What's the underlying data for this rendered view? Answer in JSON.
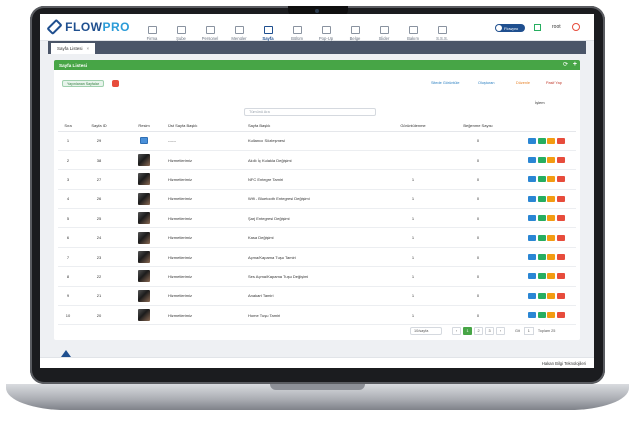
{
  "header": {
    "logo_prefix": "FLOW",
    "logo_suffix": "PRO",
    "nav": [
      {
        "label": "Firma",
        "active": false
      },
      {
        "label": "Şube",
        "active": false
      },
      {
        "label": "Personel",
        "active": false
      },
      {
        "label": "Menüler",
        "active": false
      },
      {
        "label": "Sayfa",
        "active": true
      },
      {
        "label": "Bölüm",
        "active": false
      },
      {
        "label": "Pop-Up",
        "active": false
      },
      {
        "label": "Belge",
        "active": false
      },
      {
        "label": "Slider",
        "active": false
      },
      {
        "label": "Bakım",
        "active": false
      },
      {
        "label": "S.S.S.",
        "active": false
      }
    ],
    "toggle_label": "Flowpro",
    "user": "root"
  },
  "tabs": [
    {
      "label": "Sayfa Listesi",
      "close": "×"
    }
  ],
  "panel": {
    "title": "Sayfa Listesi",
    "refresh_icon": "⟳",
    "add_icon": "+",
    "published_pill": "Yayınlanan Sayfalar",
    "links": {
      "site_view": "Sitede Görüntüle",
      "create": "Oluşturan",
      "edit": "Düzenle",
      "passive": "Pasif Yap"
    },
    "search_placeholder": "Tümünü Ara",
    "actions_header": "İşlem"
  },
  "table": {
    "headers": [
      "Sıra",
      "Sayfa ID",
      "Resim",
      "Üst Sayfa Başlık",
      "Sayfa Başlık",
      "Görüntülenme",
      "Beğenme Sayısı"
    ],
    "rows": [
      {
        "sira": "1",
        "id": "29",
        "thumb": "image-icon",
        "ust": "------",
        "baslik": "Kullanıcı Sözleşmesi",
        "goruntu": "",
        "begeni": "0"
      },
      {
        "sira": "2",
        "id": "38",
        "thumb": "photo",
        "ust": "Hizmetlerimiz",
        "baslik": "Akıllı İç Kulakla Değişimi",
        "goruntu": "",
        "begeni": "0"
      },
      {
        "sira": "3",
        "id": "27",
        "thumb": "photo",
        "ust": "Hizmetlerimiz",
        "baslik": "NFC Entegre Tamiri",
        "goruntu": "1",
        "begeni": "0"
      },
      {
        "sira": "4",
        "id": "26",
        "thumb": "photo",
        "ust": "Hizmetlerimiz",
        "baslik": "Wifi - Bluetooth Entegresi Değişimi",
        "goruntu": "1",
        "begeni": "0"
      },
      {
        "sira": "5",
        "id": "25",
        "thumb": "photo",
        "ust": "Hizmetlerimiz",
        "baslik": "Şarj Entegresi Değişimi",
        "goruntu": "1",
        "begeni": "0"
      },
      {
        "sira": "6",
        "id": "24",
        "thumb": "photo",
        "ust": "Hizmetlerimiz",
        "baslik": "Kasa Değişimi",
        "goruntu": "1",
        "begeni": "0"
      },
      {
        "sira": "7",
        "id": "23",
        "thumb": "photo",
        "ust": "Hizmetlerimiz",
        "baslik": "Açma/Kapama Tuşu Tamiri",
        "goruntu": "1",
        "begeni": "0"
      },
      {
        "sira": "8",
        "id": "22",
        "thumb": "photo",
        "ust": "Hizmetlerimiz",
        "baslik": "Ses Açma/Kapama Tuşu Değişimi",
        "goruntu": "1",
        "begeni": "0"
      },
      {
        "sira": "9",
        "id": "21",
        "thumb": "photo",
        "ust": "Hizmetlerimiz",
        "baslik": "Anakart Tamiri",
        "goruntu": "1",
        "begeni": "0"
      },
      {
        "sira": "10",
        "id": "20",
        "thumb": "photo",
        "ust": "Hizmetlerimiz",
        "baslik": "Home Tuşu Tamiri",
        "goruntu": "1",
        "begeni": "0"
      }
    ]
  },
  "pagination": {
    "per_page": "10/sayfa",
    "prev": "‹",
    "pages": [
      "1",
      "2",
      "3"
    ],
    "next": "›",
    "goto_label": "Git",
    "goto_value": "1",
    "total": "Toplam 25"
  },
  "footer": {
    "text": "Hakan Bilgi Teknolojileri"
  }
}
